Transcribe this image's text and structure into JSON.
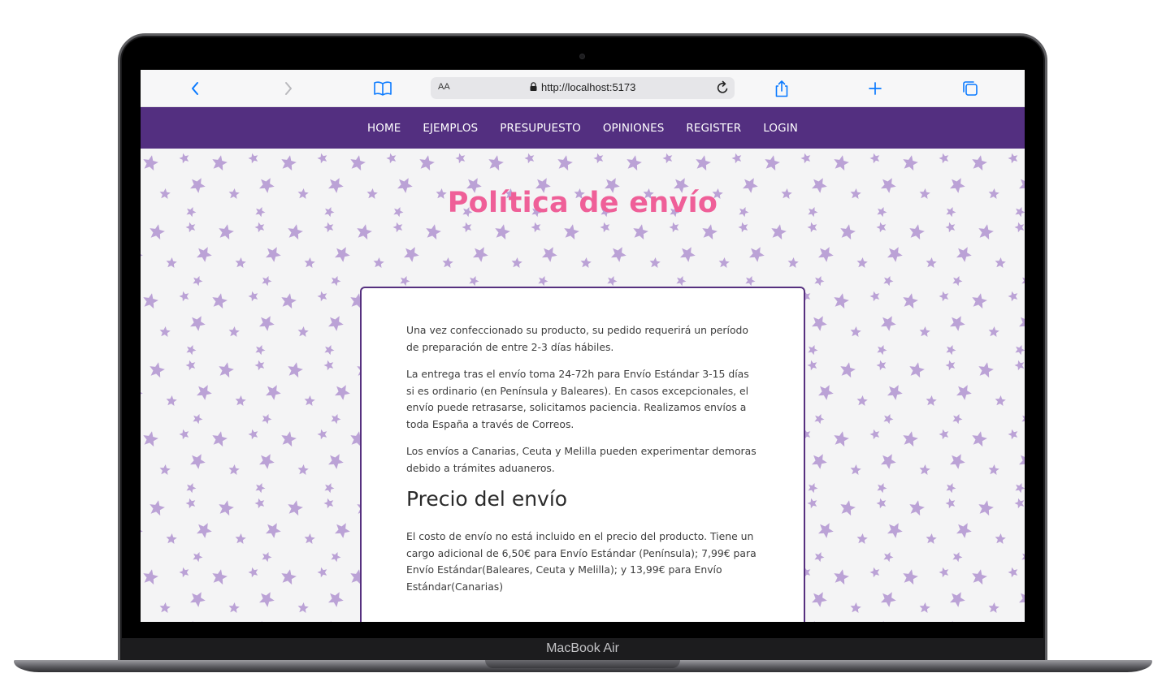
{
  "device": {
    "label": "MacBook Air"
  },
  "browser": {
    "text_size_label": "AA",
    "url": "http://localhost:5173",
    "icons": {
      "back": "chevron-left-icon",
      "forward": "chevron-right-icon",
      "bookmarks": "book-icon",
      "lock": "lock-icon",
      "reload": "reload-icon",
      "share": "share-icon",
      "new_tab": "plus-icon",
      "tabs": "tabs-icon"
    },
    "accent_color": "#0a7aff"
  },
  "nav": {
    "background": "#532f80",
    "items": [
      {
        "label": "HOME"
      },
      {
        "label": "EJEMPLOS"
      },
      {
        "label": "PRESUPUESTO"
      },
      {
        "label": "OPINIONES"
      },
      {
        "label": "REGISTER"
      },
      {
        "label": "LOGIN"
      }
    ]
  },
  "page": {
    "title": "Política de envío",
    "title_color": "#ef5f98",
    "star_color": "#bba2d6",
    "card": {
      "paragraphs": [
        "Una vez confeccionado su producto, su pedido requerirá un período de preparación de entre 2-3 días hábiles.",
        "La entrega tras el envío toma 24-72h para Envío Estándar 3-15 días si es ordinario (en Península y Baleares). En casos excepcionales, el envío puede retrasarse, solicitamos paciencia. Realizamos envíos a toda España a través de Correos.",
        "Los envíos a Canarias, Ceuta y Melilla pueden experimentar demoras debido a trámites aduaneros."
      ],
      "subheading": "Precio del envío",
      "price_paragraph": "El costo de envío no está incluido en el precio del producto. Tiene un cargo adicional de 6,50€ para Envío Estándar (Península); 7,99€ para Envío Estándar(Baleares, Ceuta y Melilla); y 13,99€ para Envío Estándar(Canarias)"
    }
  }
}
